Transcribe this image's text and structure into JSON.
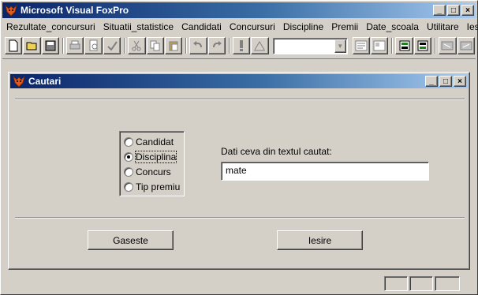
{
  "app": {
    "title": "Microsoft Visual FoxPro",
    "window_buttons": [
      "_",
      "□",
      "×"
    ]
  },
  "menu": [
    "Rezultate_concursuri",
    "Situatii_statistice",
    "Candidati",
    "Concursuri",
    "Discipline",
    "Premii",
    "Date_scoala",
    "Utilitare",
    "Iesire"
  ],
  "toolbar": {
    "combo_value": ""
  },
  "form": {
    "title": "Cautari",
    "window_buttons": [
      "_",
      "□",
      "×"
    ],
    "options": [
      "Candidat",
      "Disciplina",
      "Concurs",
      "Tip premiu"
    ],
    "selected_option": "Disciplina",
    "prompt": "Dati ceva din textul cautat:",
    "search_value": "mate",
    "find_button": "Gaseste",
    "exit_button": "Iesire"
  },
  "colors": {
    "titlebar_start": "#0a246a",
    "titlebar_end": "#a6caf0",
    "face": "#d4d0c8"
  }
}
